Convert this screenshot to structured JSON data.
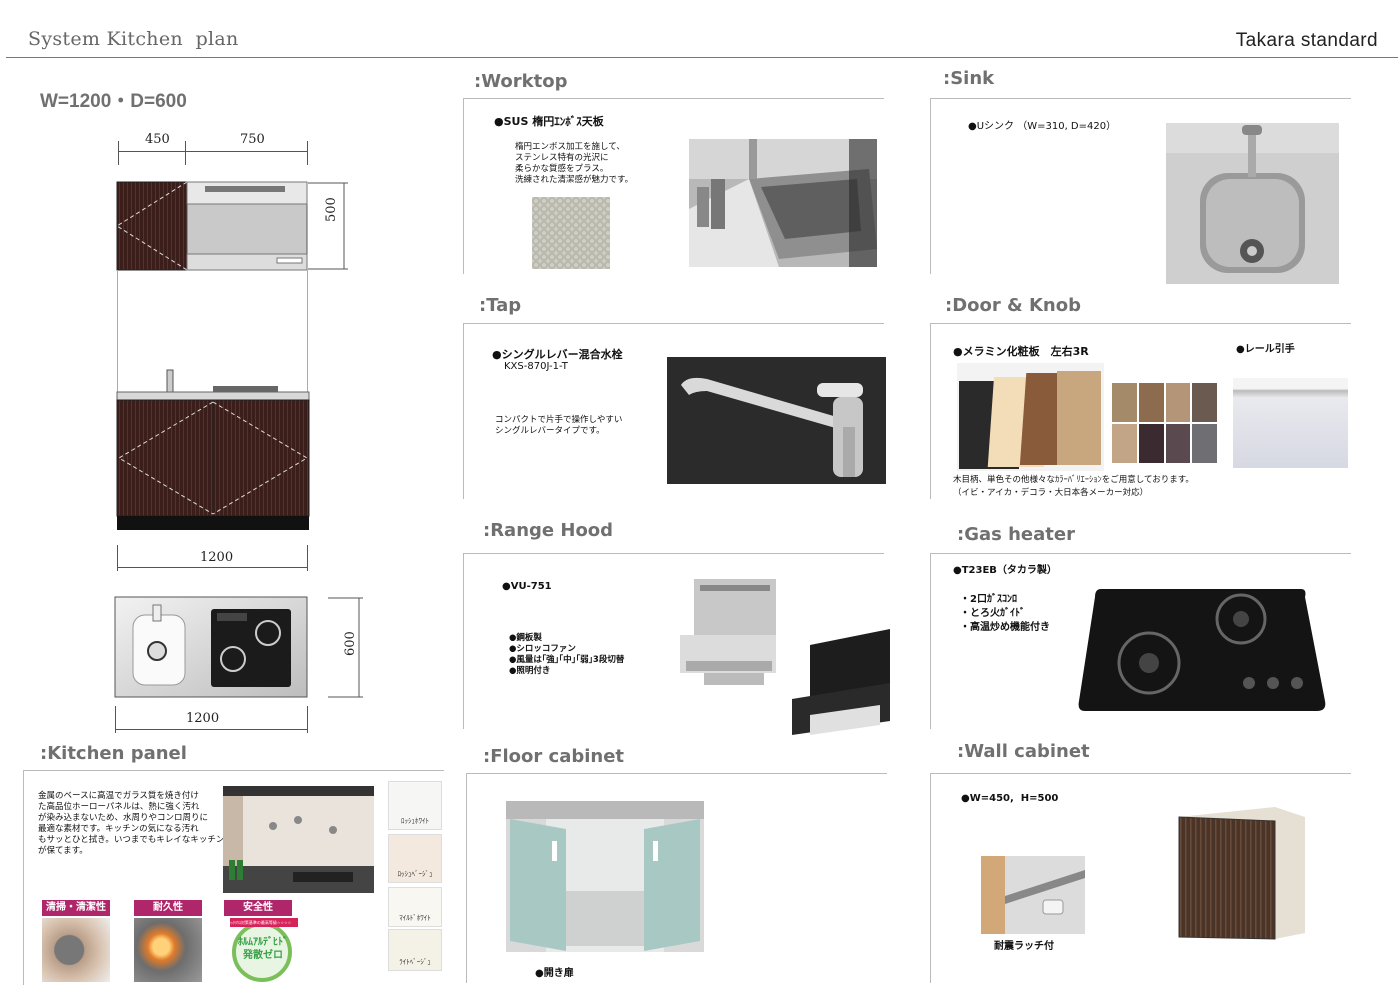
{
  "header": {
    "title": "System Kitchen  plan",
    "brand": "Takara standard"
  },
  "plan": {
    "dimensions": "W=1200・D=600",
    "dim_450": "450",
    "dim_750": "750",
    "dim_500": "500",
    "dim_1200_front": "1200",
    "dim_1200_top": "1200",
    "dim_600": "600"
  },
  "worktop": {
    "title": ":Worktop",
    "item": "●SUS 楕円ｴﾝﾎﾞｽ天板",
    "desc": "楕円エンボス加工を施して、\nステンレス特有の光沢に\n柔らかな質感をプラス。\n洗練された清潔感が魅力です。"
  },
  "sink": {
    "title": ":Sink",
    "item": "●Uシンク （W=310, D=420）"
  },
  "tap": {
    "title": ":Tap",
    "item": "●シングルレバー混合水栓",
    "model": "KXS-870J-1-T",
    "desc": "コンパクトで片手で操作しやすい\nシングルレバータイプです。"
  },
  "door": {
    "title": ":Door & Knob",
    "item": "●メラミン化粧板　左右3R",
    "knob": "●レール引手",
    "desc": "木目柄、単色その他様々なｶﾗｰﾊﾞﾘｴｰｼｮﾝをご用意しております。\n（イビ・アイカ・デコラ・大日本各メーカー対応）"
  },
  "hood": {
    "title": ":Range Hood",
    "item": "●VU-751",
    "features": "●鋼板製\n●シロッコファン\n●風量は｢強｣｢中｣｢弱｣3段切替\n●照明付き"
  },
  "gas": {
    "title": ":Gas heater",
    "item": "●T23EB（タカラ製）",
    "features": "・2口ｶﾞｽｺﾝﾛ\n・とろ火ｶﾞｲﾄﾞ\n・高温炒め機能付き"
  },
  "panel": {
    "title": ":Kitchen panel",
    "desc": "金属のベースに高温でガラス質を焼き付け\nた高品位ホーローパネルは、熱に強く汚れ\nが染み込まないため、水周りやコンロ周りに\n最適な素材です。キッチンの気になる汚れ\nもサッとひと拭き。いつまでもキレイなキッチン\nが保てます。",
    "badges": [
      "清掃・清潔性",
      "耐久性",
      "安全性"
    ],
    "swatches": [
      "ﾛｯｼｭﾎﾜｲﾄ",
      "ﾛｯｼｭﾍﾞｰｼﾞｭ",
      "ﾏｲﾙﾄﾞﾎﾜｲﾄ",
      "ﾗｲﾄﾍﾞｰｼﾞｭ"
    ],
    "stamp_top": "ｼｯｸﾊｳｽ対策基準の最高等級☆☆☆☆",
    "stamp_main": "ﾎﾙﾑｱﾙﾃﾞﾋﾄﾞ\n発散ゼロ"
  },
  "floor": {
    "title": ":Floor cabinet",
    "item": "●開き扉"
  },
  "wall": {
    "title": ":Wall cabinet",
    "item": "●W=450,  H=500",
    "latch": "耐震ラッチ付"
  }
}
